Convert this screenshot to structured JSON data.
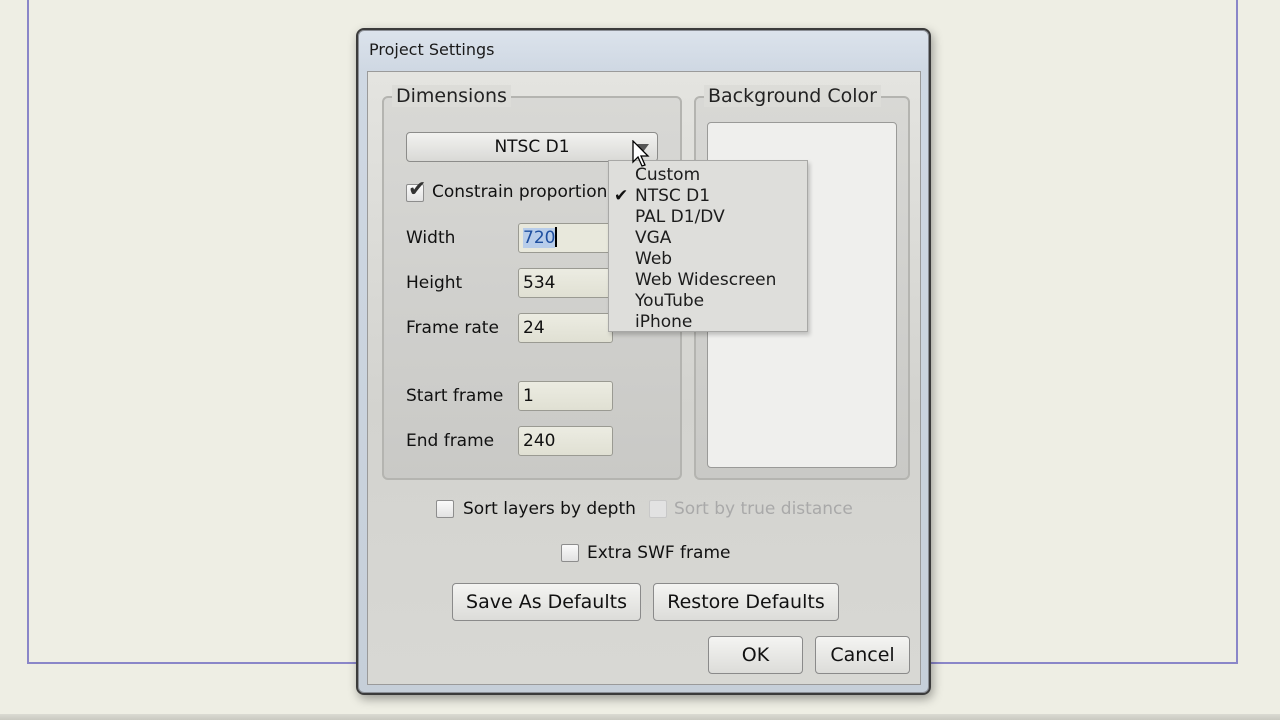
{
  "dialog": {
    "title": "Project Settings",
    "dimensions": {
      "legend": "Dimensions",
      "preset_selected": "NTSC D1",
      "constrain_label": "Constrain proportions",
      "constrain_checked": true,
      "width_label": "Width",
      "width_value": "720",
      "height_label": "Height",
      "height_value": "534",
      "frame_rate_label": "Frame rate",
      "frame_rate_value": "24",
      "start_frame_label": "Start frame",
      "start_frame_value": "1",
      "end_frame_label": "End frame",
      "end_frame_value": "240"
    },
    "background": {
      "legend": "Background Color",
      "color": "#efefed"
    },
    "options": {
      "sort_layers_label": "Sort layers by depth",
      "sort_true_distance_label": "Sort by true distance",
      "extra_swf_label": "Extra SWF frame"
    },
    "buttons": {
      "save_defaults": "Save As Defaults",
      "restore_defaults": "Restore Defaults",
      "ok": "OK",
      "cancel": "Cancel"
    }
  },
  "preset_menu": {
    "items": [
      "Custom",
      "NTSC D1",
      "PAL D1/DV",
      "VGA",
      "Web",
      "Web Widescreen",
      "YouTube",
      "iPhone"
    ],
    "checked": "NTSC D1",
    "check_glyph": "✔"
  },
  "colors": {
    "frame": "#8a86c8"
  }
}
